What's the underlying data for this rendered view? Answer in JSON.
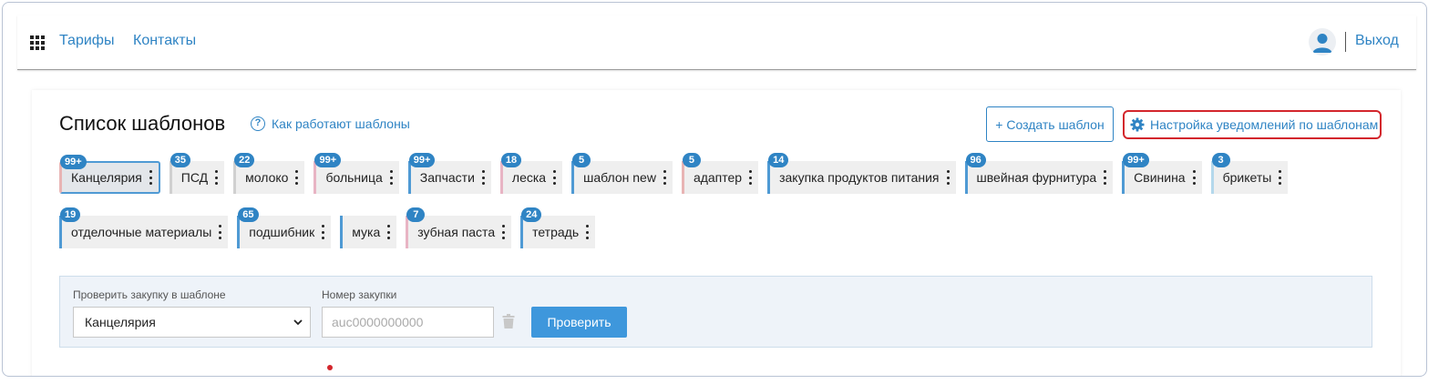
{
  "nav": {
    "links": [
      "Тарифы",
      "Контакты"
    ],
    "logout": "Выход"
  },
  "page": {
    "title": "Список шаблонов",
    "help_link": "Как работают шаблоны",
    "create_button": "+ Создать шаблон",
    "notify_link": "Настройка уведомлений по шаблонам"
  },
  "tags": [
    {
      "label": "Канцелярия",
      "badge": "99+",
      "color": "#e8b4b4",
      "active": true
    },
    {
      "label": "ПСД",
      "badge": "35",
      "color": "#d0d0d0",
      "active": false
    },
    {
      "label": "молоко",
      "badge": "22",
      "color": "#d0d0d0",
      "active": false
    },
    {
      "label": "больница",
      "badge": "99+",
      "color": "#e8b4c4",
      "active": false
    },
    {
      "label": "Запчасти",
      "badge": "99+",
      "color": "#4f9ad4",
      "active": false
    },
    {
      "label": "леска",
      "badge": "18",
      "color": "#e8b4c4",
      "active": false
    },
    {
      "label": "шаблон new",
      "badge": "5",
      "color": "#4f9ad4",
      "active": false
    },
    {
      "label": "адаптер",
      "badge": "5",
      "color": "#e8b4b4",
      "active": false
    },
    {
      "label": "закупка продуктов питания",
      "badge": "14",
      "color": "#4f9ad4",
      "active": false
    },
    {
      "label": "швейная фурнитура",
      "badge": "96",
      "color": "#4f9ad4",
      "active": false
    },
    {
      "label": "Свинина",
      "badge": "99+",
      "color": "#4f9ad4",
      "active": false
    },
    {
      "label": "брикеты",
      "badge": "3",
      "color": "#b4d8ec",
      "active": false
    },
    {
      "label": "отделочные материалы",
      "badge": "19",
      "color": "#4f9ad4",
      "active": false
    },
    {
      "label": "подшибник",
      "badge": "65",
      "color": "#4f9ad4",
      "active": false
    },
    {
      "label": "мука",
      "badge": "",
      "color": "#4f9ad4",
      "active": false
    },
    {
      "label": "зубная паста",
      "badge": "7",
      "color": "#e8b4c4",
      "active": false
    },
    {
      "label": "тетрадь",
      "badge": "24",
      "color": "#4f9ad4",
      "active": false
    }
  ],
  "check": {
    "template_label": "Проверить закупку в шаблоне",
    "template_value": "Канцелярия",
    "number_label": "Номер закупки",
    "number_placeholder": "auc0000000000",
    "check_button": "Проверить"
  },
  "colors": {
    "accent": "#2f84c4",
    "button": "#3e97dc",
    "highlight_border": "#d3262c"
  }
}
